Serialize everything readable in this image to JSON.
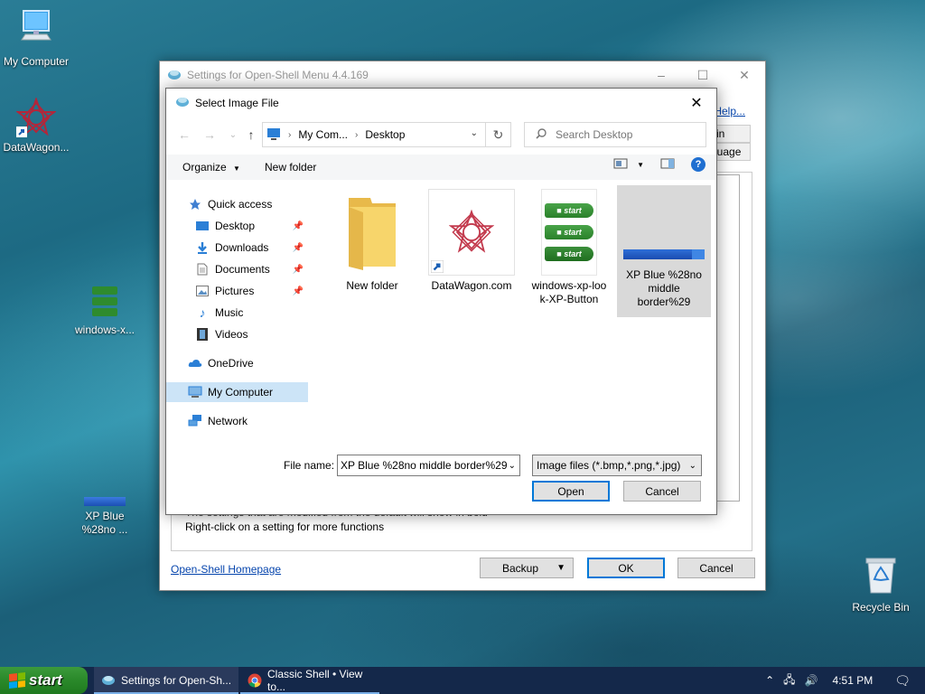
{
  "desktop": {
    "icons": [
      {
        "label": "My Computer"
      },
      {
        "label": "DataWagon..."
      },
      {
        "label": "windows-x..."
      },
      {
        "label_line1": "XP Blue",
        "label_line2": "%28no ..."
      },
      {
        "label": "Recycle Bin"
      }
    ]
  },
  "settings_window": {
    "title": "Settings for Open-Shell Menu 4.4.169",
    "help_link": "Help...",
    "tab_skin": "kin",
    "tab_language": "guage",
    "hint_line1": "The settings that are modified from the default will show in bold",
    "hint_line2": "Right-click on a setting for more functions",
    "homepage_link": "Open-Shell Homepage",
    "backup_label": "Backup",
    "ok_label": "OK",
    "cancel_label": "Cancel"
  },
  "dialog": {
    "title": "Select Image File",
    "address": {
      "segments": [
        "My Com...",
        "Desktop"
      ]
    },
    "search_placeholder": "Search Desktop",
    "toolbar": {
      "organize": "Organize",
      "new_folder": "New folder"
    },
    "nav": [
      {
        "label": "Quick access"
      },
      {
        "label": "Desktop",
        "pinned": true
      },
      {
        "label": "Downloads",
        "pinned": true
      },
      {
        "label": "Documents",
        "pinned": true
      },
      {
        "label": "Pictures",
        "pinned": true
      },
      {
        "label": "Music"
      },
      {
        "label": "Videos"
      },
      {
        "label": "OneDrive"
      },
      {
        "label": "My Computer",
        "selected": true
      },
      {
        "label": "Network"
      }
    ],
    "files": [
      {
        "name": "New folder"
      },
      {
        "name": "DataWagon.com"
      },
      {
        "name_line1": "windows-xp-loo",
        "name_line2": "k-XP-Button"
      },
      {
        "name_line1": "XP Blue %28no",
        "name_line2": "middle",
        "name_line3": "border%29",
        "selected": true
      }
    ],
    "file_name_label": "File name:",
    "file_name_value": "XP Blue %28no middle border%29",
    "file_type_value": "Image files (*.bmp,*.png,*.jpg)",
    "open_label": "Open",
    "cancel_label": "Cancel"
  },
  "taskbar": {
    "start_label": "start",
    "tasks": [
      {
        "label": "Settings for Open-Sh...",
        "active": true
      },
      {
        "label": "Classic Shell • View to..."
      }
    ],
    "clock": "4:51 PM"
  },
  "colors": {
    "accent": "#0078d7",
    "taskbar": "#14284a",
    "start_green": "#2b8a2b",
    "selection": "#cce4f7"
  }
}
